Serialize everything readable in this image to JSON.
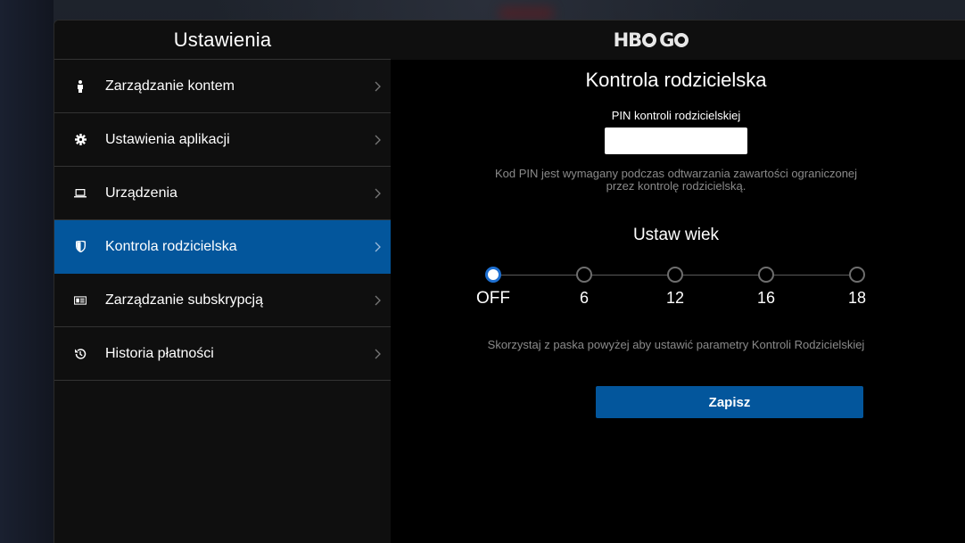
{
  "sidebar": {
    "title": "Ustawienia",
    "items": [
      {
        "label": "Zarządzanie kontem",
        "icon": "person-icon",
        "active": false
      },
      {
        "label": "Ustawienia aplikacji",
        "icon": "gear-icon",
        "active": false
      },
      {
        "label": "Urządzenia",
        "icon": "laptop-icon",
        "active": false
      },
      {
        "label": "Kontrola rodzicielska",
        "icon": "shield-icon",
        "active": true
      },
      {
        "label": "Zarządzanie subskrypcją",
        "icon": "card-icon",
        "active": false
      },
      {
        "label": "Historia płatności",
        "icon": "history-icon",
        "active": false
      }
    ]
  },
  "header": {
    "logo": {
      "part1": "HB",
      "part2": "G"
    }
  },
  "parental": {
    "title": "Kontrola rodzicielska",
    "pin_label": "PIN kontroli rodzicielskiej",
    "pin_value": "",
    "pin_description_line1": "Kod PIN jest wymagany podczas odtwarzania zawartości ograniczonej",
    "pin_description_line2": "przez kontrolę rodzicielską.",
    "age_title": "Ustaw wiek",
    "age_options": [
      "OFF",
      "6",
      "12",
      "16",
      "18"
    ],
    "selected_age": "OFF",
    "hint": "Skorzystaj z paska powyżej aby ustawić parametry Kontroli Rodzicielskiej",
    "save_label": "Zapisz"
  },
  "colors": {
    "accent": "#03569c",
    "slider_selected": "#1d6fd1"
  }
}
